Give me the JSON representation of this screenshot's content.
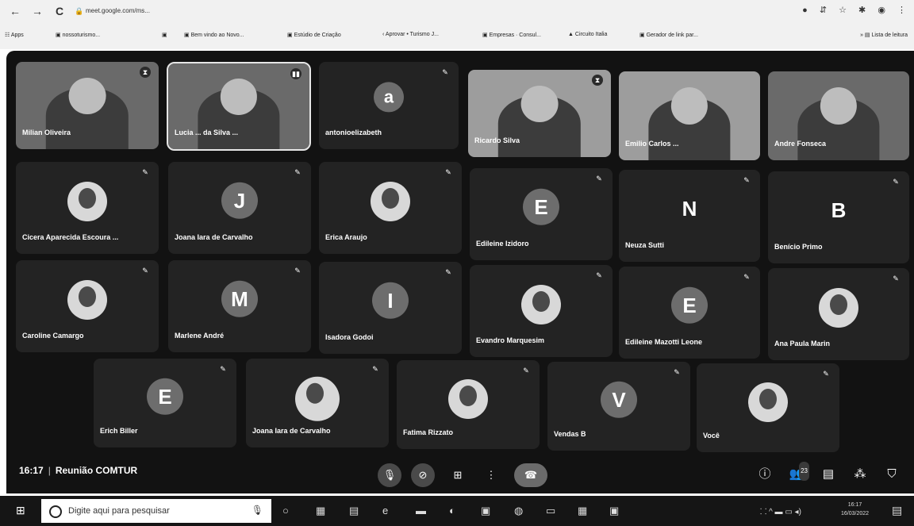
{
  "browser": {
    "back_icon": "←",
    "forward_icon": "→",
    "reload_icon": "C",
    "lock_icon": "🔒",
    "address": "meet.google.com/ms...",
    "right_icons": [
      "●",
      "⇵",
      "☆",
      "✱",
      "◉",
      "⋮"
    ],
    "bookmarks": [
      {
        "icon": "☷",
        "label": "Apps"
      },
      {
        "icon": "▣",
        "label": "nossoturismo..."
      },
      {
        "icon": "▣",
        "label": ""
      },
      {
        "icon": "▣",
        "label": "Bem vindo ao Novo..."
      },
      {
        "icon": "▣",
        "label": "Estúdio de Criação"
      },
      {
        "icon": "‹",
        "label": "Aprovar • Turismo J..."
      },
      {
        "icon": "▣",
        "label": "Empresas · Consul..."
      },
      {
        "icon": "▲",
        "label": "Circuito Italia"
      },
      {
        "icon": "▣",
        "label": "Gerador de link par..."
      }
    ],
    "reading_list": "Lista de leitura"
  },
  "participants_top": [
    {
      "name": "Milian Oliveira",
      "type": "video",
      "mute": "⧗"
    },
    {
      "name": "Lucia ... da Silva ...",
      "type": "video",
      "mute": "▮▮",
      "framed": true
    },
    {
      "name": "antonioelizabeth",
      "type": "avatar",
      "initial": "a",
      "mute": "✎"
    },
    {
      "name": "Ricardo Silva",
      "type": "video",
      "mute": "⧗",
      "light": true
    },
    {
      "name": "Emilio Carlos ...",
      "type": "video",
      "mute": ""
    },
    {
      "name": "Andre Fonseca",
      "type": "video",
      "mute": ""
    }
  ],
  "participants_row2": [
    {
      "name": "Cicera Aparecida Escoura ...",
      "type": "photo"
    },
    {
      "name": "Joana Iara de Carvalho",
      "type": "avatar",
      "initial": "J"
    },
    {
      "name": "Erica Araujo",
      "type": "photo"
    },
    {
      "name": "Edileine Izidoro",
      "type": "avatar",
      "initial": "E"
    },
    {
      "name": "Neuza Sutti",
      "type": "plain",
      "initial": "N"
    },
    {
      "name": "Benício Primo",
      "type": "plain",
      "initial": "B"
    }
  ],
  "participants_row3": [
    {
      "name": "Caroline Camargo",
      "type": "photo"
    },
    {
      "name": "Marlene André",
      "type": "avatar",
      "initial": "M"
    },
    {
      "name": "Isadora Godoi",
      "type": "avatar",
      "initial": "I"
    },
    {
      "name": "Evandro Marquesim",
      "type": "photo"
    },
    {
      "name": "Edileine Mazotti Leone",
      "type": "avatar",
      "initial": "E"
    },
    {
      "name": "Ana Paula Marin",
      "type": "photo"
    }
  ],
  "participants_row4": [
    {
      "name": "Erich Biller",
      "type": "avatar",
      "initial": "E"
    },
    {
      "name": "Joana Iara de Carvalho",
      "type": "video"
    },
    {
      "name": "Fatima Rizzato",
      "type": "photo"
    },
    {
      "name": "Vendas B",
      "type": "avatar",
      "initial": "V"
    },
    {
      "name": "Você",
      "type": "photo"
    }
  ],
  "mute_glyph": "✎",
  "meeting": {
    "time": "16:17",
    "separator": "|",
    "title": "Reunião COMTUR"
  },
  "controls": {
    "mic_icon": "🎙",
    "camera_icon": "⊘",
    "present_icon": "⊞",
    "more_icon": "⋮",
    "hangup_icon": "☎"
  },
  "side_controls": {
    "info_icon": "ⓘ",
    "people_icon": "👥",
    "people_count": "23",
    "chat_icon": "▤",
    "activities_icon": "⁂",
    "host_icon": "⛉"
  },
  "taskbar": {
    "start_icon": "⊞",
    "search_placeholder": "Digite aqui para pesquisar",
    "mic_icon": "🎙",
    "apps": [
      "○",
      "▦",
      "▤",
      "e",
      "▬",
      "◐",
      "▣",
      "◍",
      "▭",
      "▦",
      "▣"
    ],
    "tray": "⸬ ^ ▬ ▭ ◂)",
    "clock_time": "16:17",
    "clock_date": "16/03/2022",
    "notification_icon": "▤"
  }
}
